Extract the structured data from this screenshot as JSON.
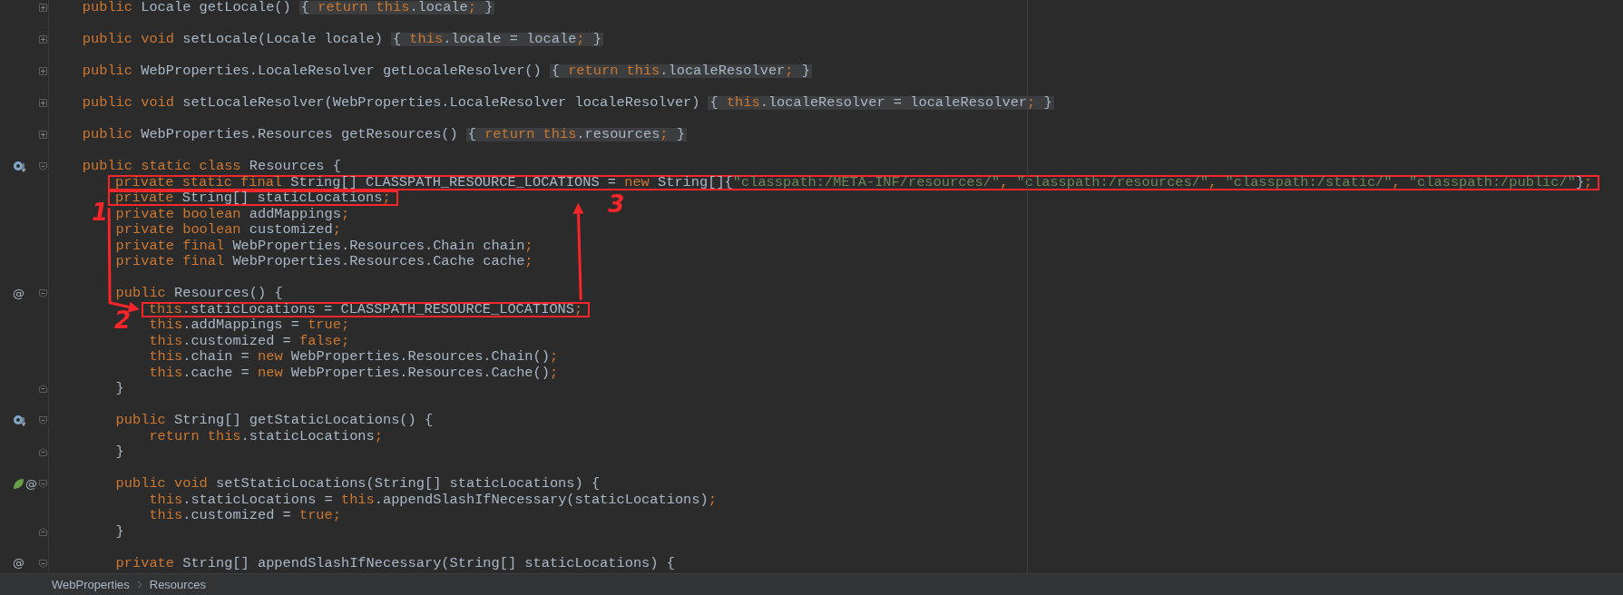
{
  "editor": {
    "lines": [
      {
        "kind": "code",
        "boxed": false,
        "fold": {
          "kind": "collapsed"
        },
        "tokens": [
          {
            "kind": "keyword",
            "text": "public"
          },
          {
            "kind": "plain",
            "text": " Locale getLocale()"
          }
        ],
        "folded_body": [
          {
            "kind": "plain",
            "text": "{ "
          },
          {
            "kind": "keyword",
            "text": "return this"
          },
          {
            "kind": "plain",
            "text": ".locale"
          },
          {
            "kind": "punct",
            "text": ";"
          },
          {
            "kind": "plain",
            "text": " }"
          }
        ]
      },
      {
        "kind": "blank"
      },
      {
        "kind": "code",
        "boxed": false,
        "fold": {
          "kind": "collapsed"
        },
        "tokens": [
          {
            "kind": "keyword",
            "text": "public void"
          },
          {
            "kind": "plain",
            "text": " setLocale(Locale locale)"
          }
        ],
        "folded_body": [
          {
            "kind": "plain",
            "text": "{ "
          },
          {
            "kind": "keyword",
            "text": "this"
          },
          {
            "kind": "plain",
            "text": ".locale = locale"
          },
          {
            "kind": "punct",
            "text": ";"
          },
          {
            "kind": "plain",
            "text": " }"
          }
        ]
      },
      {
        "kind": "blank"
      },
      {
        "kind": "code",
        "boxed": false,
        "fold": {
          "kind": "collapsed"
        },
        "tokens": [
          {
            "kind": "keyword",
            "text": "public"
          },
          {
            "kind": "plain",
            "text": " WebProperties.LocaleResolver getLocaleResolver()"
          }
        ],
        "folded_body": [
          {
            "kind": "plain",
            "text": "{ "
          },
          {
            "kind": "keyword",
            "text": "return this"
          },
          {
            "kind": "plain",
            "text": ".localeResolver"
          },
          {
            "kind": "punct",
            "text": ";"
          },
          {
            "kind": "plain",
            "text": " }"
          }
        ]
      },
      {
        "kind": "blank"
      },
      {
        "kind": "code",
        "boxed": false,
        "fold": {
          "kind": "collapsed"
        },
        "tokens": [
          {
            "kind": "keyword",
            "text": "public void"
          },
          {
            "kind": "plain",
            "text": " setLocaleResolver(WebProperties.LocaleResolver localeResolver)"
          }
        ],
        "folded_body": [
          {
            "kind": "plain",
            "text": "{ "
          },
          {
            "kind": "keyword",
            "text": "this"
          },
          {
            "kind": "plain",
            "text": ".localeResolver = localeResolver"
          },
          {
            "kind": "punct",
            "text": ";"
          },
          {
            "kind": "plain",
            "text": " }"
          }
        ]
      },
      {
        "kind": "blank"
      },
      {
        "kind": "code",
        "boxed": false,
        "fold": {
          "kind": "collapsed"
        },
        "tokens": [
          {
            "kind": "keyword",
            "text": "public"
          },
          {
            "kind": "plain",
            "text": " WebProperties.Resources getResources()"
          }
        ],
        "folded_body": [
          {
            "kind": "plain",
            "text": "{ "
          },
          {
            "kind": "keyword",
            "text": "return this"
          },
          {
            "kind": "plain",
            "text": ".resources"
          },
          {
            "kind": "punct",
            "text": ";"
          },
          {
            "kind": "plain",
            "text": " }"
          }
        ]
      },
      {
        "kind": "blank"
      },
      {
        "kind": "code",
        "boxed": false,
        "fold": {
          "kind": "start"
        },
        "gutter": {
          "kind": "override"
        },
        "tokens": [
          {
            "kind": "keyword",
            "text": "public static class"
          },
          {
            "kind": "plain",
            "text": " Resources {"
          }
        ],
        "children": [
          {
            "kind": "code",
            "boxed": true,
            "tokens": [
              {
                "kind": "keyword",
                "text": "private static final"
              },
              {
                "kind": "plain",
                "text": " String[] CLASSPATH_RESOURCE_LOCATIONS = "
              },
              {
                "kind": "keyword",
                "text": "new"
              },
              {
                "kind": "plain",
                "text": " String[]{"
              },
              {
                "kind": "string",
                "text": "\"classpath:/META-INF/resources/\""
              },
              {
                "kind": "punct",
                "text": ", "
              },
              {
                "kind": "string",
                "text": "\"classpath:/resources/\""
              },
              {
                "kind": "punct",
                "text": ", "
              },
              {
                "kind": "string",
                "text": "\"classpath:/static/\""
              },
              {
                "kind": "punct",
                "text": ", "
              },
              {
                "kind": "string",
                "text": "\"classpath:/public/\""
              },
              {
                "kind": "plain",
                "text": "}"
              },
              {
                "kind": "punct",
                "text": ";"
              }
            ]
          },
          {
            "kind": "code",
            "boxed": true,
            "tokens": [
              {
                "kind": "keyword",
                "text": "private"
              },
              {
                "kind": "plain",
                "text": " String[] staticLocations"
              },
              {
                "kind": "punct",
                "text": ";"
              }
            ]
          },
          {
            "kind": "code",
            "boxed": false,
            "tokens": [
              {
                "kind": "keyword",
                "text": "private boolean"
              },
              {
                "kind": "plain",
                "text": " addMappings"
              },
              {
                "kind": "punct",
                "text": ";"
              }
            ]
          },
          {
            "kind": "code",
            "boxed": false,
            "tokens": [
              {
                "kind": "keyword",
                "text": "private boolean"
              },
              {
                "kind": "plain",
                "text": " customized"
              },
              {
                "kind": "punct",
                "text": ";"
              }
            ]
          },
          {
            "kind": "code",
            "boxed": false,
            "tokens": [
              {
                "kind": "keyword",
                "text": "private final"
              },
              {
                "kind": "plain",
                "text": " WebProperties.Resources.Chain chain"
              },
              {
                "kind": "punct",
                "text": ";"
              }
            ]
          },
          {
            "kind": "code",
            "boxed": false,
            "tokens": [
              {
                "kind": "keyword",
                "text": "private final"
              },
              {
                "kind": "plain",
                "text": " WebProperties.Resources.Cache cache"
              },
              {
                "kind": "punct",
                "text": ";"
              }
            ]
          },
          {
            "kind": "blank"
          },
          {
            "kind": "code",
            "boxed": false,
            "fold": {
              "kind": "start"
            },
            "gutter": {
              "kind": "annotation",
              "text": "@"
            },
            "tokens": [
              {
                "kind": "keyword",
                "text": "public"
              },
              {
                "kind": "plain",
                "text": " Resources() {"
              }
            ],
            "children": [
              {
                "kind": "code",
                "boxed": true,
                "tokens": [
                  {
                    "kind": "keyword",
                    "text": "this"
                  },
                  {
                    "kind": "plain",
                    "text": ".staticLocations = CLASSPATH_RESOURCE_LOCATIONS"
                  },
                  {
                    "kind": "punct",
                    "text": ";"
                  }
                ]
              },
              {
                "kind": "code",
                "boxed": false,
                "tokens": [
                  {
                    "kind": "keyword",
                    "text": "this"
                  },
                  {
                    "kind": "plain",
                    "text": ".addMappings = "
                  },
                  {
                    "kind": "keyword",
                    "text": "true"
                  },
                  {
                    "kind": "punct",
                    "text": ";"
                  }
                ]
              },
              {
                "kind": "code",
                "boxed": false,
                "tokens": [
                  {
                    "kind": "keyword",
                    "text": "this"
                  },
                  {
                    "kind": "plain",
                    "text": ".customized = "
                  },
                  {
                    "kind": "keyword",
                    "text": "false"
                  },
                  {
                    "kind": "punct",
                    "text": ";"
                  }
                ]
              },
              {
                "kind": "code",
                "boxed": false,
                "tokens": [
                  {
                    "kind": "keyword",
                    "text": "this"
                  },
                  {
                    "kind": "plain",
                    "text": ".chain = "
                  },
                  {
                    "kind": "keyword",
                    "text": "new"
                  },
                  {
                    "kind": "plain",
                    "text": " WebProperties.Resources.Chain()"
                  },
                  {
                    "kind": "punct",
                    "text": ";"
                  }
                ]
              },
              {
                "kind": "code",
                "boxed": false,
                "tokens": [
                  {
                    "kind": "keyword",
                    "text": "this"
                  },
                  {
                    "kind": "plain",
                    "text": ".cache = "
                  },
                  {
                    "kind": "keyword",
                    "text": "new"
                  },
                  {
                    "kind": "plain",
                    "text": " WebProperties.Resources.Cache()"
                  },
                  {
                    "kind": "punct",
                    "text": ";"
                  }
                ]
              }
            ]
          },
          {
            "kind": "code",
            "boxed": false,
            "fold": {
              "kind": "end"
            },
            "tokens": [
              {
                "kind": "plain",
                "text": "}"
              }
            ]
          },
          {
            "kind": "blank"
          },
          {
            "kind": "code",
            "boxed": false,
            "fold": {
              "kind": "start"
            },
            "gutter": {
              "kind": "override"
            },
            "tokens": [
              {
                "kind": "keyword",
                "text": "public"
              },
              {
                "kind": "plain",
                "text": " String[] getStaticLocations() {"
              }
            ],
            "children": [
              {
                "kind": "code",
                "boxed": false,
                "tokens": [
                  {
                    "kind": "keyword",
                    "text": "return this"
                  },
                  {
                    "kind": "plain",
                    "text": ".staticLocations"
                  },
                  {
                    "kind": "punct",
                    "text": ";"
                  }
                ]
              }
            ]
          },
          {
            "kind": "code",
            "boxed": false,
            "fold": {
              "kind": "end"
            },
            "tokens": [
              {
                "kind": "plain",
                "text": "}"
              }
            ]
          },
          {
            "kind": "blank"
          },
          {
            "kind": "code",
            "boxed": false,
            "fold": {
              "kind": "start"
            },
            "gutter": {
              "kind": "bean",
              "text": "@"
            },
            "tokens": [
              {
                "kind": "keyword",
                "text": "public void"
              },
              {
                "kind": "plain",
                "text": " setStaticLocations(String[] staticLocations) {"
              }
            ],
            "children": [
              {
                "kind": "code",
                "boxed": false,
                "tokens": [
                  {
                    "kind": "keyword",
                    "text": "this"
                  },
                  {
                    "kind": "plain",
                    "text": ".staticLocations = "
                  },
                  {
                    "kind": "keyword",
                    "text": "this"
                  },
                  {
                    "kind": "plain",
                    "text": ".appendSlashIfNecessary(staticLocations)"
                  },
                  {
                    "kind": "punct",
                    "text": ";"
                  }
                ]
              },
              {
                "kind": "code",
                "boxed": false,
                "tokens": [
                  {
                    "kind": "keyword",
                    "text": "this"
                  },
                  {
                    "kind": "plain",
                    "text": ".customized = "
                  },
                  {
                    "kind": "keyword",
                    "text": "true"
                  },
                  {
                    "kind": "punct",
                    "text": ";"
                  }
                ]
              }
            ]
          },
          {
            "kind": "code",
            "boxed": false,
            "fold": {
              "kind": "end"
            },
            "tokens": [
              {
                "kind": "plain",
                "text": "}"
              }
            ]
          },
          {
            "kind": "blank"
          },
          {
            "kind": "code",
            "boxed": false,
            "fold": {
              "kind": "start"
            },
            "gutter": {
              "kind": "annotation",
              "text": "@"
            },
            "tokens": [
              {
                "kind": "keyword",
                "text": "private"
              },
              {
                "kind": "plain",
                "text": " String[] appendSlashIfNecessary(String[] staticLocations) {"
              }
            ]
          }
        ]
      }
    ],
    "annotations": [
      {
        "label": "1"
      },
      {
        "label": "2"
      },
      {
        "label": "3"
      }
    ]
  },
  "breadcrumbs": [
    {
      "label": "WebProperties"
    },
    {
      "label": "Resources"
    }
  ]
}
